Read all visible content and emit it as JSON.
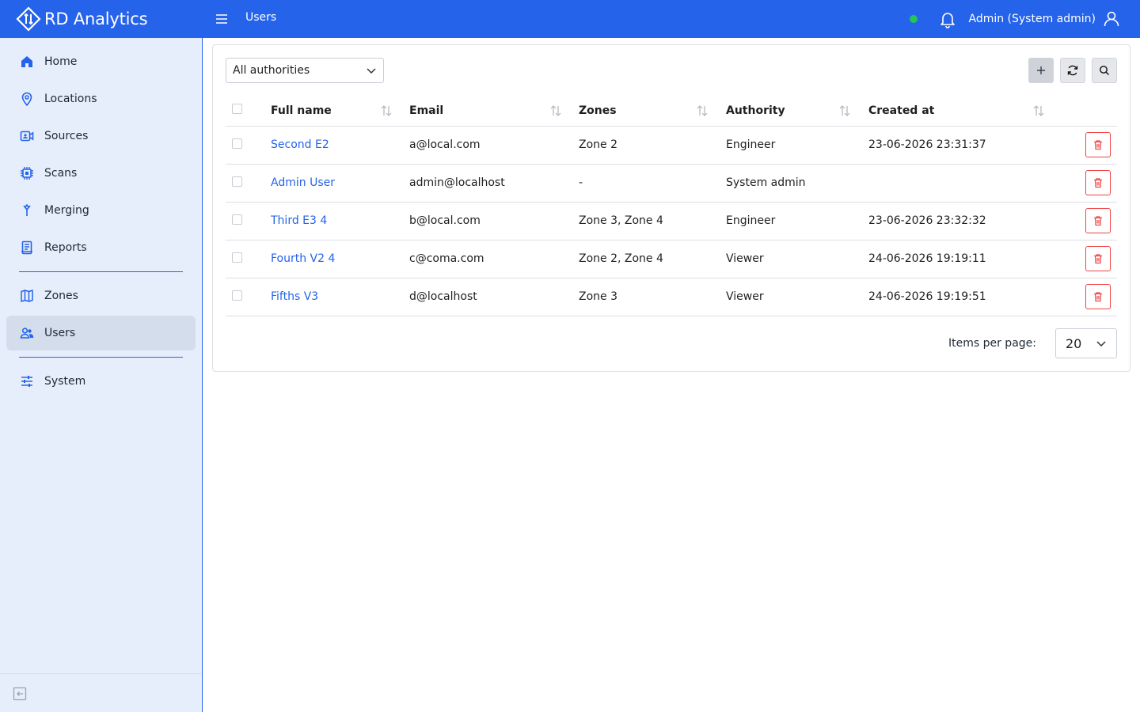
{
  "app": {
    "brand": "RD Analytics",
    "page_title": "Users",
    "user_label": "Admin (System admin)",
    "status_color": "#22c55e",
    "accent_color": "#2563eb"
  },
  "sidebar": {
    "items": [
      {
        "label": "Home",
        "icon": "home-icon"
      },
      {
        "label": "Locations",
        "icon": "location-pin-icon"
      },
      {
        "label": "Sources",
        "icon": "camera-icon"
      },
      {
        "label": "Scans",
        "icon": "chip-icon"
      },
      {
        "label": "Merging",
        "icon": "merge-icon"
      },
      {
        "label": "Reports",
        "icon": "report-icon"
      },
      {
        "label": "Zones",
        "icon": "map-icon"
      },
      {
        "label": "Users",
        "icon": "users-icon",
        "active": true
      },
      {
        "label": "System",
        "icon": "sliders-icon"
      }
    ]
  },
  "filter": {
    "selected": "All authorities"
  },
  "table": {
    "headers": {
      "full_name": "Full name",
      "email": "Email",
      "zones": "Zones",
      "authority": "Authority",
      "created_at": "Created at"
    },
    "rows": [
      {
        "full_name": "Second E2",
        "email": "a@local.com",
        "zones": "Zone 2",
        "authority": "Engineer",
        "created_at": "23-06-2026 23:31:37"
      },
      {
        "full_name": "Admin User",
        "email": "admin@localhost",
        "zones": "-",
        "authority": "System admin",
        "created_at": ""
      },
      {
        "full_name": "Third E3 4",
        "email": "b@local.com",
        "zones": "Zone 3, Zone 4",
        "authority": "Engineer",
        "created_at": "23-06-2026 23:32:32"
      },
      {
        "full_name": "Fourth V2 4",
        "email": "c@coma.com",
        "zones": "Zone 2, Zone 4",
        "authority": "Viewer",
        "created_at": "24-06-2026 19:19:11"
      },
      {
        "full_name": "Fifths V3",
        "email": "d@localhost",
        "zones": "Zone 3",
        "authority": "Viewer",
        "created_at": "24-06-2026 19:19:51"
      }
    ]
  },
  "pager": {
    "label": "Items per page:",
    "value": "20"
  }
}
